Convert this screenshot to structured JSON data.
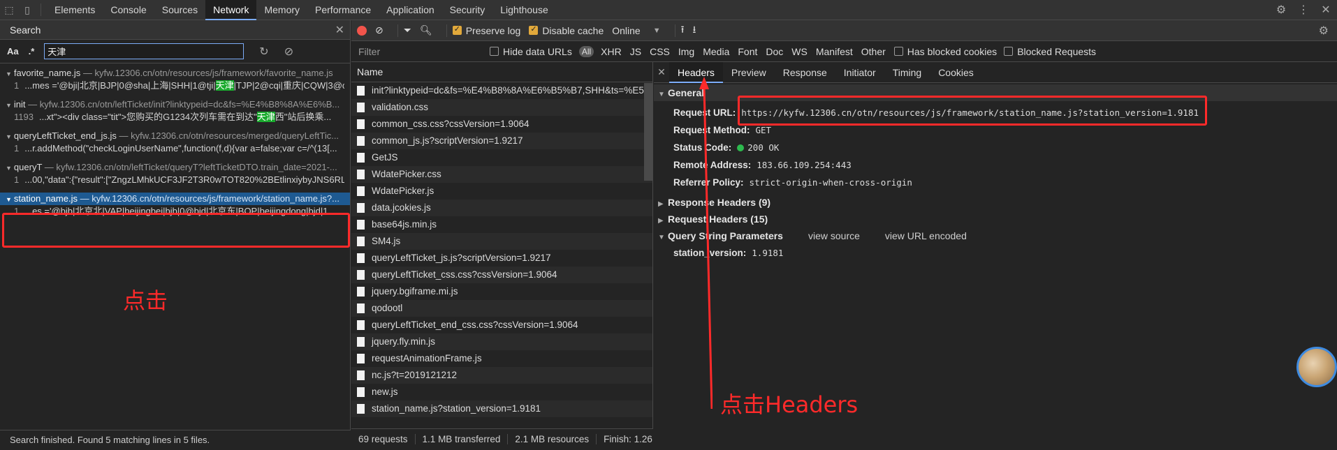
{
  "devtools": {
    "tabs": [
      "Elements",
      "Console",
      "Sources",
      "Network",
      "Memory",
      "Performance",
      "Application",
      "Security",
      "Lighthouse"
    ],
    "active_tab": "Network"
  },
  "search": {
    "title": "Search",
    "case_label": "Aa",
    "regex_label": ".*",
    "query": "天津",
    "results": [
      {
        "file": "favorite_name.js",
        "url": "— kyfw.12306.cn/otn/resources/js/framework/favorite_name.js",
        "line_no": "1",
        "pre": "...mes ='@bji|北京|BJP|0@sha|上海|SHH|1@tji|",
        "hit": "天津",
        "post": "|TJP|2@cqi|重庆|CQW|3@c..."
      },
      {
        "file": "init",
        "url": "— kyfw.12306.cn/otn/leftTicket/init?linktypeid=dc&fs=%E4%B8%8A%E6%B...",
        "line_no": "1193",
        "pre": "...xt\"><div class=\"tit\">您购买的G1234次列车需在到达\"",
        "hit": "天津",
        "post": "西\"站后换乘..."
      },
      {
        "file": "queryLeftTicket_end_js.js",
        "url": "— kyfw.12306.cn/otn/resources/merged/queryLeftTic...",
        "line_no": "1",
        "pre": "...r.addMethod(\"checkLoginUserName\",function(f,d){var a=false;var c=/^(13[...",
        "hit": "",
        "post": ""
      },
      {
        "file": "queryT",
        "url": "— kyfw.12306.cn/otn/leftTicket/queryT?leftTicketDTO.train_date=2021-...",
        "line_no": "1",
        "pre": "...00,\"data\":{\"result\":[\"ZngzLMhkUCF3JF2T3R0wTOT820%2BEtlinxiybyJNS6RLJ...",
        "hit": "",
        "post": ""
      },
      {
        "file": "station_name.js",
        "url": "— kyfw.12306.cn/otn/resources/js/framework/station_name.js?...",
        "line_no": "1",
        "pre": "...es ='@bjb|北京北|VAP|beijingbei|bjb|0@bjd|北京东|BOP|beijingdong|bjd|1...",
        "hit": "",
        "post": ""
      }
    ],
    "annotation_click": "点击",
    "footer": "Search finished.  Found 5 matching lines in 5 files."
  },
  "network": {
    "preserve_log": "Preserve log",
    "disable_cache": "Disable cache",
    "throttle": "Online",
    "filter_placeholder": "Filter",
    "hide_data_urls": "Hide data URLs",
    "types": [
      "All",
      "XHR",
      "JS",
      "CSS",
      "Img",
      "Media",
      "Font",
      "Doc",
      "WS",
      "Manifest",
      "Other"
    ],
    "has_blocked_cookies": "Has blocked cookies",
    "blocked_requests": "Blocked Requests",
    "name_header": "Name",
    "requests": [
      "init?linktypeid=dc&fs=%E4%B8%8A%E6%B5%B7,SHH&ts=%E5...",
      "validation.css",
      "common_css.css?cssVersion=1.9064",
      "common_js.js?scriptVersion=1.9217",
      "GetJS",
      "WdatePicker.css",
      "WdatePicker.js",
      "data.jcokies.js",
      "base64js.min.js",
      "SM4.js",
      "queryLeftTicket_js.js?scriptVersion=1.9217",
      "queryLeftTicket_css.css?cssVersion=1.9064",
      "jquery.bgiframe.mi.js",
      "qodootl",
      "queryLeftTicket_end_css.css?cssVersion=1.9064",
      "jquery.fly.min.js",
      "requestAnimationFrame.js",
      "nc.js?t=2019121212",
      "new.js",
      "station_name.js?station_version=1.9181"
    ],
    "summary": {
      "requests": "69 requests",
      "transferred": "1.1 MB transferred",
      "resources": "2.1 MB resources",
      "finish": "Finish: 1.26 :"
    }
  },
  "details": {
    "tabs": [
      "Headers",
      "Preview",
      "Response",
      "Initiator",
      "Timing",
      "Cookies"
    ],
    "active_tab": "Headers",
    "general_title": "General",
    "general": [
      {
        "k": "Request URL:",
        "v": "https://kyfw.12306.cn/otn/resources/js/framework/station_name.js?station_version=1.9181"
      },
      {
        "k": "Request Method:",
        "v": "GET"
      },
      {
        "k": "Status Code:",
        "v": "200 OK"
      },
      {
        "k": "Remote Address:",
        "v": "183.66.109.254:443"
      },
      {
        "k": "Referrer Policy:",
        "v": "strict-origin-when-cross-origin"
      }
    ],
    "response_headers": "Response Headers (9)",
    "request_headers": "Request Headers (15)",
    "query_title": "Query String Parameters",
    "view_source": "view source",
    "view_url_encoded": "view URL encoded",
    "query_key": "station_version:",
    "query_val": "1.9181",
    "annotation_headers": "点击Headers"
  },
  "colors": {
    "annotation_red": "#ff2a2a",
    "accent_blue": "#7cacf8",
    "selected_row": "#1e5a92",
    "match_highlight": "#1aab2e",
    "status_green": "#2dba4e"
  }
}
